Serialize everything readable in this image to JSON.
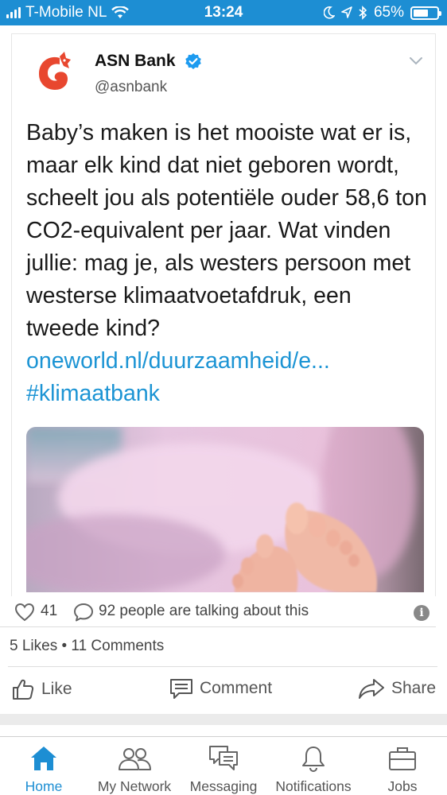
{
  "status_bar": {
    "carrier": "T-Mobile NL",
    "time": "13:24",
    "battery_percent": "65%",
    "battery_level": 0.65,
    "icons": [
      "signal-icon",
      "wifi-icon",
      "moon-icon",
      "location-icon",
      "bluetooth-icon",
      "battery-icon"
    ]
  },
  "tweet": {
    "author_name": "ASN Bank",
    "handle": "@asnbank",
    "verified": true,
    "text": "Baby’s maken is het mooiste wat er is, maar elk kind dat niet geboren wordt, scheelt jou als potentiële ouder 58,6 ton CO2-equivalent per jaar. Wat vinden jullie: mag je, als westers persoon met westerse klimaatvoetafdruk, een tweede kind? ",
    "link_text": "oneworld.nl/duurzaamheid/e...",
    "hashtag": "#klimaatbank",
    "image_subject": "baby feet under pink blanket",
    "colors": {
      "link": "#1c94d4",
      "brand_red": "#e8472f"
    }
  },
  "social": {
    "likes": "41",
    "talking": "92 people are talking about this",
    "summary": "5 Likes • 11 Comments"
  },
  "actions": {
    "like": "Like",
    "comment": "Comment",
    "share": "Share"
  },
  "bottom_nav": {
    "accent": "#1d8ed3",
    "items": [
      {
        "label": "Home",
        "icon": "home-icon",
        "active": true
      },
      {
        "label": "My Network",
        "icon": "people-icon",
        "active": false
      },
      {
        "label": "Messaging",
        "icon": "messaging-icon",
        "active": false
      },
      {
        "label": "Notifications",
        "icon": "bell-icon",
        "active": false
      },
      {
        "label": "Jobs",
        "icon": "briefcase-icon",
        "active": false
      }
    ]
  }
}
